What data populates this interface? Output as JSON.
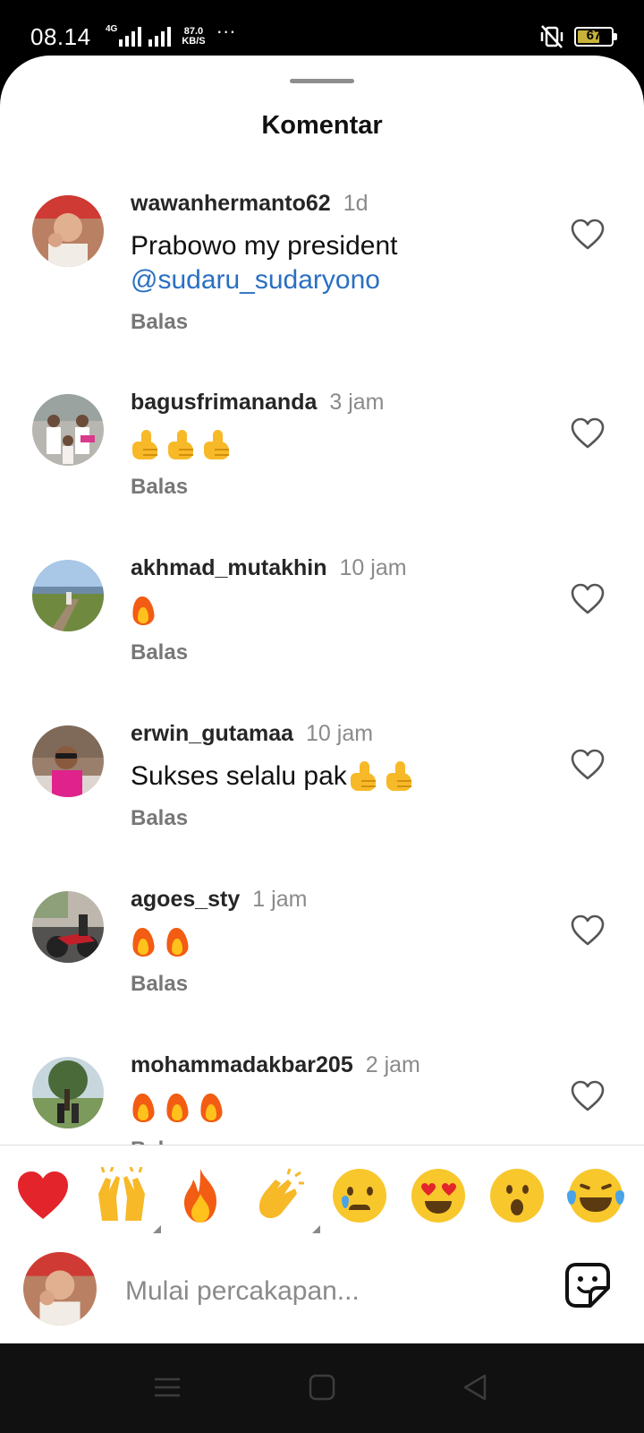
{
  "status_bar": {
    "time": "08.14",
    "network_type": "4G",
    "speed_value": "87.0",
    "speed_unit": "KB/S",
    "more": "···",
    "battery": "67"
  },
  "sheet": {
    "title": "Komentar"
  },
  "comments": [
    {
      "username": "wawanhermanto62",
      "time": "1d",
      "text": "Prabowo my president",
      "mention": "@sudaru_sudaryono",
      "reply_label": "Balas",
      "emoji": []
    },
    {
      "username": "bagusfrimananda",
      "time": "3 jam",
      "text": "",
      "mention": "",
      "reply_label": "Balas",
      "emoji": [
        "thumbs-up",
        "thumbs-up",
        "thumbs-up"
      ]
    },
    {
      "username": "akhmad_mutakhin",
      "time": "10 jam",
      "text": "",
      "mention": "",
      "reply_label": "Balas",
      "emoji": [
        "fire"
      ]
    },
    {
      "username": "erwin_gutamaa",
      "time": "10 jam",
      "text": "Sukses selalu pak",
      "mention": "",
      "reply_label": "Balas",
      "emoji": [
        "thumbs-up",
        "thumbs-up"
      ]
    },
    {
      "username": "agoes_sty",
      "time": "1 jam",
      "text": "",
      "mention": "",
      "reply_label": "Balas",
      "emoji": [
        "fire",
        "fire"
      ]
    },
    {
      "username": "mohammadakbar205",
      "time": "2 jam",
      "text": "",
      "mention": "",
      "reply_label": "Balas",
      "emoji": [
        "fire",
        "fire",
        "fire"
      ]
    }
  ],
  "reactions": [
    "red-heart",
    "raising-hands",
    "fire",
    "clapping-hands",
    "crying-face",
    "heart-eyes",
    "surprised-face",
    "tears-of-joy"
  ],
  "composer": {
    "placeholder": "Mulai percakapan..."
  },
  "colors": {
    "mention": "#2a6fc2",
    "timestamp": "#8a8a8a",
    "reply": "#777777"
  }
}
